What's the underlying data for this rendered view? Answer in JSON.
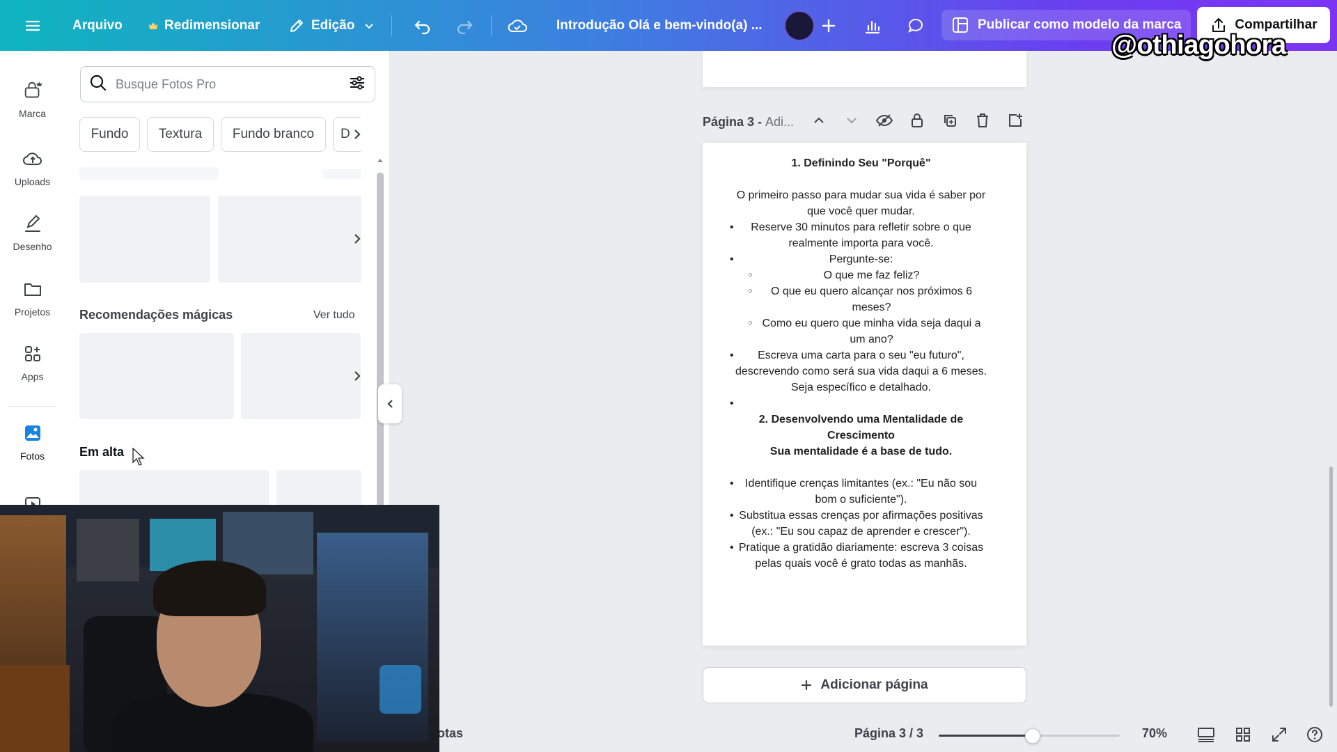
{
  "topbar": {
    "menu_icon": "hamburger-menu-icon",
    "file_label": "Arquivo",
    "resize_label": "Redimensionar",
    "edit_label": "Edição",
    "document_title": "Introdução Olá e bem-vindo(a) ...",
    "publish_label": "Publicar como modelo da marca",
    "share_label": "Compartilhar",
    "watermark": "@othiagohora"
  },
  "rail": {
    "items": [
      {
        "label": "Marca",
        "icon": "brand-icon"
      },
      {
        "label": "Uploads",
        "icon": "cloud-upload-icon"
      },
      {
        "label": "Desenho",
        "icon": "draw-icon"
      },
      {
        "label": "Projetos",
        "icon": "folder-icon"
      },
      {
        "label": "Apps",
        "icon": "apps-icon"
      },
      {
        "label": "Fotos",
        "icon": "photos-icon"
      }
    ]
  },
  "panel": {
    "search_placeholder": "Busque Fotos Pro",
    "chips": [
      "Fundo",
      "Textura",
      "Fundo branco",
      "D"
    ],
    "section_magic": "Recomendações mágicas",
    "see_all": "Ver tudo",
    "section_trending": "Em alta"
  },
  "page": {
    "title": "Página 3 -",
    "subtitle": "Adi...",
    "add_page_label": "Adicionar página"
  },
  "document": {
    "h1": "1. Definindo Seu \"Porquê\"",
    "intro": "O primeiro passo para mudar sua vida é saber por que você quer mudar.",
    "b1": "Reserve 30 minutos para refletir sobre o que realmente importa para você.",
    "b2": "Pergunte-se:",
    "q1": "O que me faz feliz?",
    "q2": "O que eu quero alcançar nos próximos 6 meses?",
    "q3": "Como eu quero que minha vida seja daqui a um ano?",
    "b3": "Escreva uma carta para o seu \"eu futuro\", descrevendo como será sua vida daqui a 6 meses. Seja específico e detalhado.",
    "h2": "2. Desenvolvendo uma Mentalidade de Crescimento",
    "h2_sub": "Sua mentalidade é a base de tudo.",
    "c1": "Identifique crenças limitantes (ex.: \"Eu não sou bom o suficiente\").",
    "c2": "Substitua essas crenças por afirmações positivas (ex.: \"Eu sou capaz de aprender e crescer\").",
    "c3": "Pratique a gratidão diariamente: escreva 3 coisas pelas quais você é grato todas as manhãs."
  },
  "footer": {
    "notes_fragment": "otas",
    "page_count": "Página 3 / 3",
    "zoom_level": "70%",
    "zoom_fraction": 0.52
  }
}
